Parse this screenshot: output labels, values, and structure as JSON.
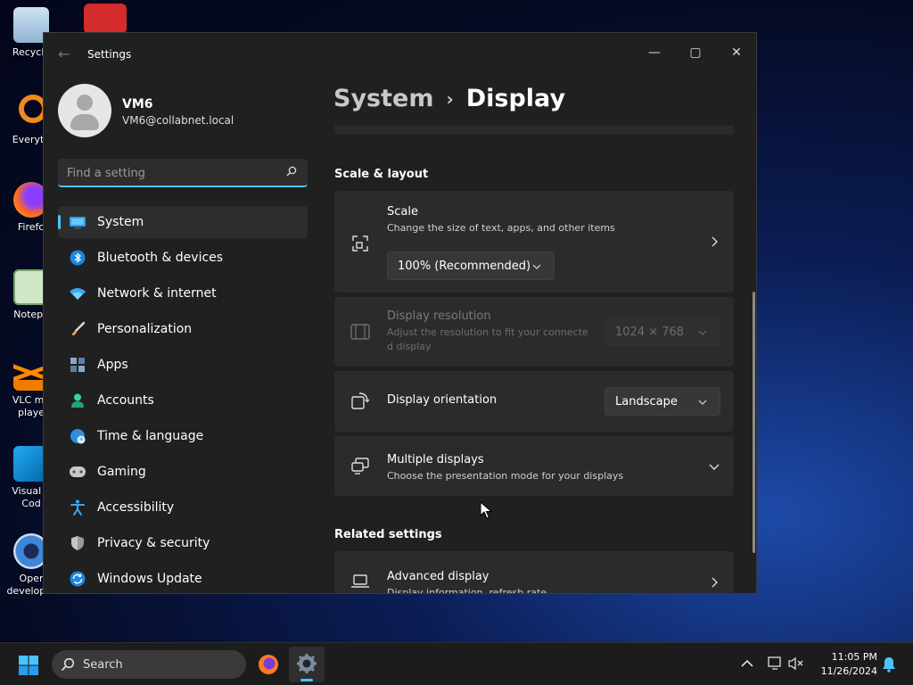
{
  "desktop": {
    "icons": [
      {
        "label": "Recycle",
        "icon": "recycle-bin-icon"
      },
      {
        "label": "Everyth",
        "icon": "search-everything-icon"
      },
      {
        "label": "Firefo",
        "icon": "firefox-icon"
      },
      {
        "label": "Notepa",
        "icon": "notepad-icon"
      },
      {
        "label": "VLC me",
        "label2": "playe",
        "icon": "vlc-icon"
      },
      {
        "label": "Visual S",
        "label2": "Cod",
        "icon": "vscode-icon"
      },
      {
        "label": "Oper",
        "label2": "developer",
        "icon": "opera-icon"
      }
    ]
  },
  "window": {
    "title": "Settings",
    "controls": {
      "minimize": "—",
      "maximize": "▢",
      "close": "✕"
    }
  },
  "sidebar": {
    "user": {
      "name": "VM6",
      "email": "VM6@collabnet.local"
    },
    "search_placeholder": "Find a setting",
    "items": [
      {
        "label": "System",
        "icon": "system-display-icon",
        "active": true
      },
      {
        "label": "Bluetooth & devices",
        "icon": "bluetooth-icon"
      },
      {
        "label": "Network & internet",
        "icon": "wifi-icon"
      },
      {
        "label": "Personalization",
        "icon": "paintbrush-icon"
      },
      {
        "label": "Apps",
        "icon": "apps-icon"
      },
      {
        "label": "Accounts",
        "icon": "accounts-icon"
      },
      {
        "label": "Time & language",
        "icon": "globe-clock-icon"
      },
      {
        "label": "Gaming",
        "icon": "gamepad-icon"
      },
      {
        "label": "Accessibility",
        "icon": "accessibility-icon"
      },
      {
        "label": "Privacy & security",
        "icon": "shield-icon"
      },
      {
        "label": "Windows Update",
        "icon": "windows-update-icon"
      }
    ]
  },
  "main": {
    "breadcrumb": {
      "parent": "System",
      "separator": "›",
      "current": "Display"
    },
    "scale_layout": {
      "section_title": "Scale & layout",
      "scale": {
        "title": "Scale",
        "subtitle": "Change the size of text, apps, and other items",
        "value": "100% (Recommended)"
      },
      "resolution": {
        "title": "Display resolution",
        "subtitle_line1": "Adjust the resolution to fit your connecte",
        "subtitle_line2": "d display",
        "value": "1024 × 768",
        "disabled": true
      },
      "orientation": {
        "title": "Display orientation",
        "value": "Landscape"
      },
      "multiple": {
        "title": "Multiple displays",
        "subtitle": "Choose the presentation mode for your displays"
      }
    },
    "related": {
      "section_title": "Related settings",
      "advanced": {
        "title": "Advanced display",
        "subtitle": "Display information, refresh rate"
      }
    }
  },
  "taskbar": {
    "search_label": "Search",
    "time": "11:05 PM",
    "date": "11/26/2024"
  },
  "colors": {
    "accent": "#4cc2ff",
    "window_bg": "#202020",
    "card_bg": "#2b2b2b"
  }
}
